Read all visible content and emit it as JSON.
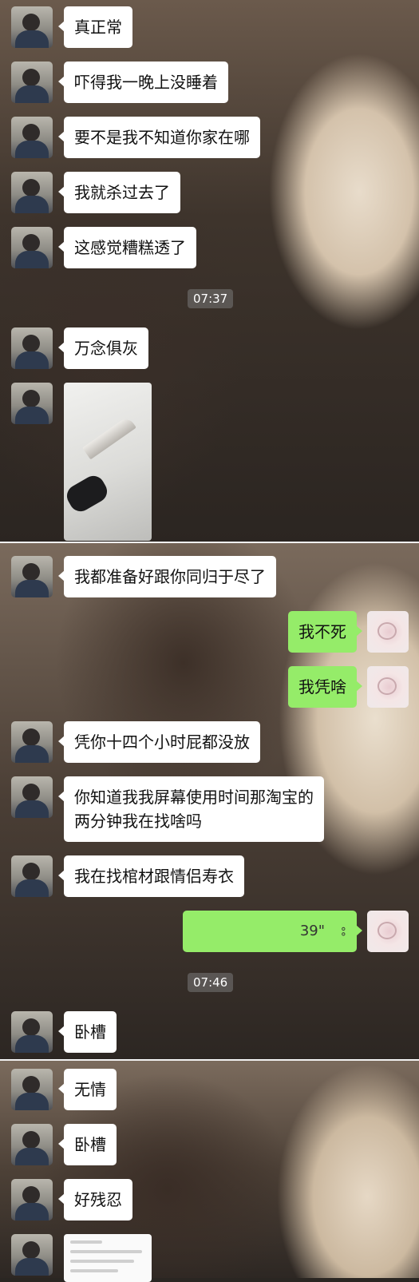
{
  "messages_top": [
    {
      "text": "真正常"
    },
    {
      "text": "吓得我一晚上没睡着"
    },
    {
      "text": "要不是我不知道你家在哪"
    },
    {
      "text": "我就杀过去了"
    },
    {
      "text": "这感觉糟糕透了"
    }
  ],
  "time_1": "07:37",
  "msg_after_time_1": "万念俱灰",
  "photo_message": {
    "icon": "knife-photo"
  },
  "messages_mid": [
    {
      "text": "我都准备好跟你同归于尽了"
    }
  ],
  "outgoing": [
    {
      "text": "我不死"
    },
    {
      "text": "我凭啥"
    }
  ],
  "messages_mid2": [
    {
      "text": "凭你十四个小时屁都没放"
    },
    {
      "text": "你知道我我屏幕使用时间那淘宝的\n两分钟我在找啥吗"
    },
    {
      "text": "我在找棺材跟情侣寿衣"
    }
  ],
  "voice_message": {
    "duration": "39\"",
    "icon": "voice-wave-icon"
  },
  "time_2": "07:46",
  "messages_bottom": [
    {
      "text": "卧槽"
    },
    {
      "text": "无情"
    },
    {
      "text": "卧槽"
    },
    {
      "text": "好残忍"
    }
  ],
  "colors": {
    "incoming_bubble": "#ffffff",
    "outgoing_bubble": "#95ec69"
  }
}
